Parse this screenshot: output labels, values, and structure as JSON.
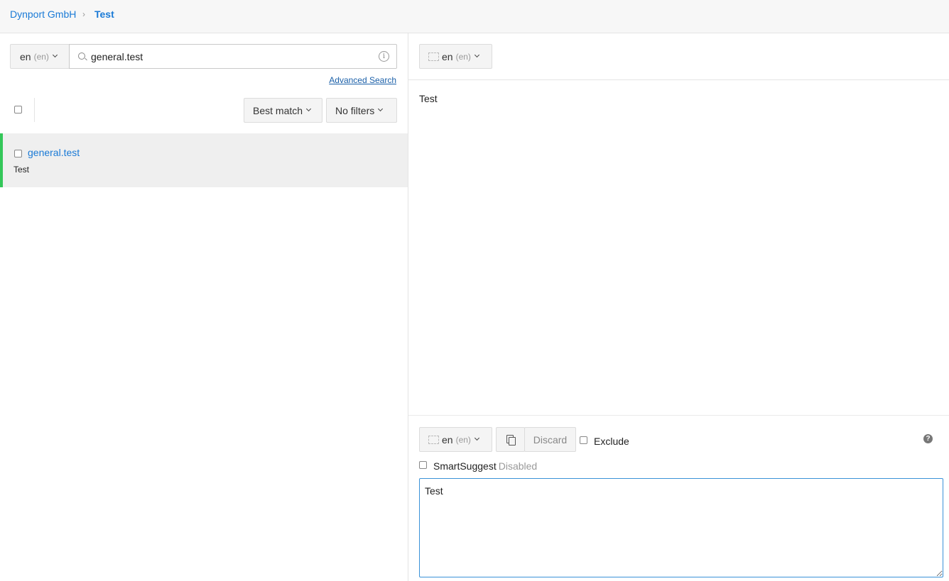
{
  "breadcrumb": {
    "organization": "Dynport GmbH",
    "separator": "›",
    "project": "Test"
  },
  "search": {
    "locale": {
      "code": "en",
      "name": "(en)"
    },
    "query": "general.test",
    "info_symbol": "i",
    "advanced_link": "Advanced Search"
  },
  "list_controls": {
    "sort_label": "Best match",
    "filter_label": "No filters"
  },
  "keys": [
    {
      "name": "general.test",
      "value": "Test"
    }
  ],
  "source": {
    "locale": {
      "code": "en",
      "name": "(en)"
    },
    "text": "Test"
  },
  "editor": {
    "locale": {
      "code": "en",
      "name": "(en)"
    },
    "discard_label": "Discard",
    "exclude_label": "Exclude",
    "help_symbol": "?",
    "smartsuggest_label": "SmartSuggest",
    "smartsuggest_state": "Disabled",
    "value": "Test"
  },
  "colors": {
    "link": "#1a7ad6",
    "active_indicator": "#34c759",
    "editor_border": "#3a92d8"
  }
}
